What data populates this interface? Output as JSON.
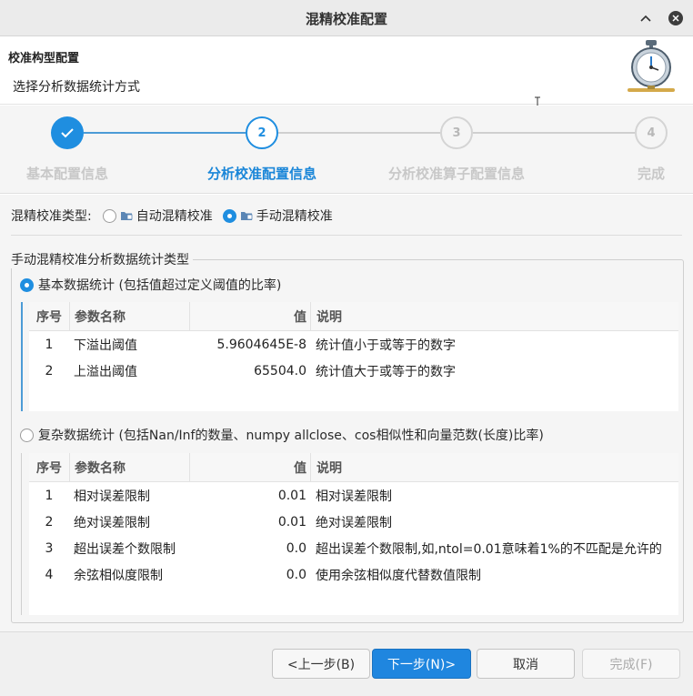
{
  "window": {
    "title": "混精校准配置"
  },
  "header": {
    "title": "校准构型配置",
    "subtitle": "选择分析数据统计方式"
  },
  "steps": [
    {
      "num": "1",
      "label": "基本配置信息",
      "state": "done"
    },
    {
      "num": "2",
      "label": "分析校准配置信息",
      "state": "active"
    },
    {
      "num": "3",
      "label": "分析校准算子配置信息",
      "state": "todo"
    },
    {
      "num": "4",
      "label": "完成",
      "state": "todo"
    }
  ],
  "calibration_type": {
    "label": "混精校准类型:",
    "options": [
      {
        "label": "自动混精校准",
        "selected": false
      },
      {
        "label": "手动混精校准",
        "selected": true
      }
    ]
  },
  "group": {
    "legend": "手动混精校准分析数据统计类型",
    "basic": {
      "label": "基本数据统计 (包括值超过定义阈值的比率)",
      "selected": true,
      "columns": [
        "序号",
        "参数名称",
        "值",
        "说明"
      ],
      "rows": [
        {
          "no": "1",
          "name": "下溢出阈值",
          "value": "5.9604645E-8",
          "desc": "统计值小于或等于的数字"
        },
        {
          "no": "2",
          "name": "上溢出阈值",
          "value": "65504.0",
          "desc": "统计值大于或等于的数字"
        }
      ]
    },
    "complex": {
      "label": "复杂数据统计 (包括Nan/Inf的数量、numpy allclose、cos相似性和向量范数(长度)比率)",
      "selected": false,
      "columns": [
        "序号",
        "参数名称",
        "值",
        "说明"
      ],
      "rows": [
        {
          "no": "1",
          "name": "相对误差限制",
          "value": "0.01",
          "desc": "相对误差限制"
        },
        {
          "no": "2",
          "name": "绝对误差限制",
          "value": "0.01",
          "desc": "绝对误差限制"
        },
        {
          "no": "3",
          "name": "超出误差个数限制",
          "value": "0.0",
          "desc": "超出误差个数限制,如,ntol=0.01意味着1%的不匹配是允许的"
        },
        {
          "no": "4",
          "name": "余弦相似度限制",
          "value": "0.0",
          "desc": "使用余弦相似度代替数值限制"
        }
      ]
    }
  },
  "footer": {
    "prev": "<上一步(B)",
    "next": "下一步(N)>",
    "cancel": "取消",
    "finish": "完成(F)"
  },
  "colors": {
    "accent": "#1f8ee0",
    "primary_button": "#1f86df"
  }
}
